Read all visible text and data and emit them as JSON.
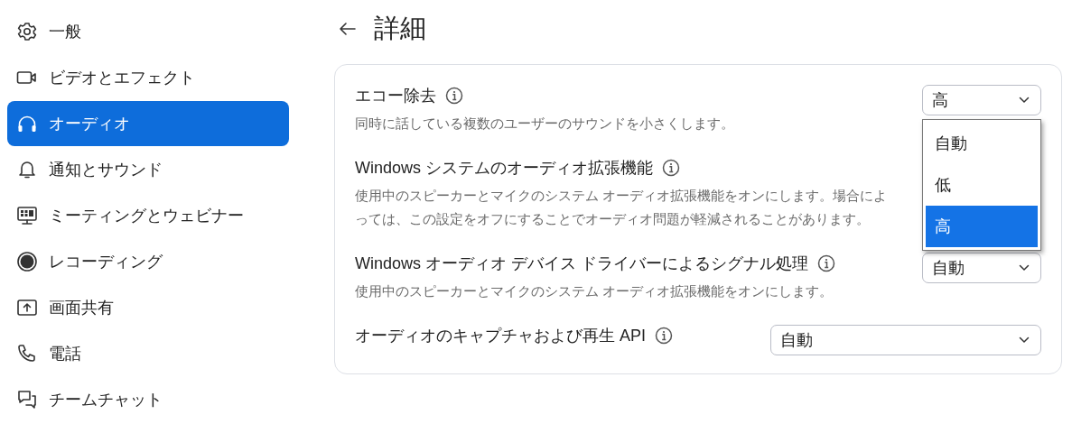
{
  "sidebar": {
    "items": [
      {
        "label": "一般",
        "kind": "gear",
        "selected": false
      },
      {
        "label": "ビデオとエフェクト",
        "kind": "camera",
        "selected": false
      },
      {
        "label": "オーディオ",
        "kind": "headphones",
        "selected": true
      },
      {
        "label": "通知とサウンド",
        "kind": "bell",
        "selected": false
      },
      {
        "label": "ミーティングとウェビナー",
        "kind": "monitor",
        "selected": false
      },
      {
        "label": "レコーディング",
        "kind": "record",
        "selected": false
      },
      {
        "label": "画面共有",
        "kind": "share",
        "selected": false
      },
      {
        "label": "電話",
        "kind": "phone",
        "selected": false
      },
      {
        "label": "チームチャット",
        "kind": "chat",
        "selected": false
      }
    ]
  },
  "page": {
    "title": "詳細"
  },
  "settings": [
    {
      "title": "エコー除去",
      "description": "同時に話している複数のユーザーのサウンドを小さくします。",
      "control": {
        "value": "高",
        "kind": "compact",
        "options": [
          {
            "label": "自動",
            "selected": false
          },
          {
            "label": "低",
            "selected": false
          },
          {
            "label": "高",
            "selected": true
          }
        ]
      }
    },
    {
      "title": "Windows システムのオーディオ拡張機能",
      "description": "使用中のスピーカーとマイクのシステム オーディオ拡張機能をオンにします。場合によっては、この設定をオフにすることでオーディオ問題が軽減されることがあります。"
    },
    {
      "title": "Windows オーディオ デバイス ドライバーによるシグナル処理",
      "description": "使用中のスピーカーとマイクのシステム オーディオ拡張機能をオンにします。",
      "control": {
        "value": "自動",
        "kind": "compact"
      }
    },
    {
      "title": "オーディオのキャプチャおよび再生 API",
      "control": {
        "value": "自動",
        "kind": "wide"
      }
    }
  ]
}
